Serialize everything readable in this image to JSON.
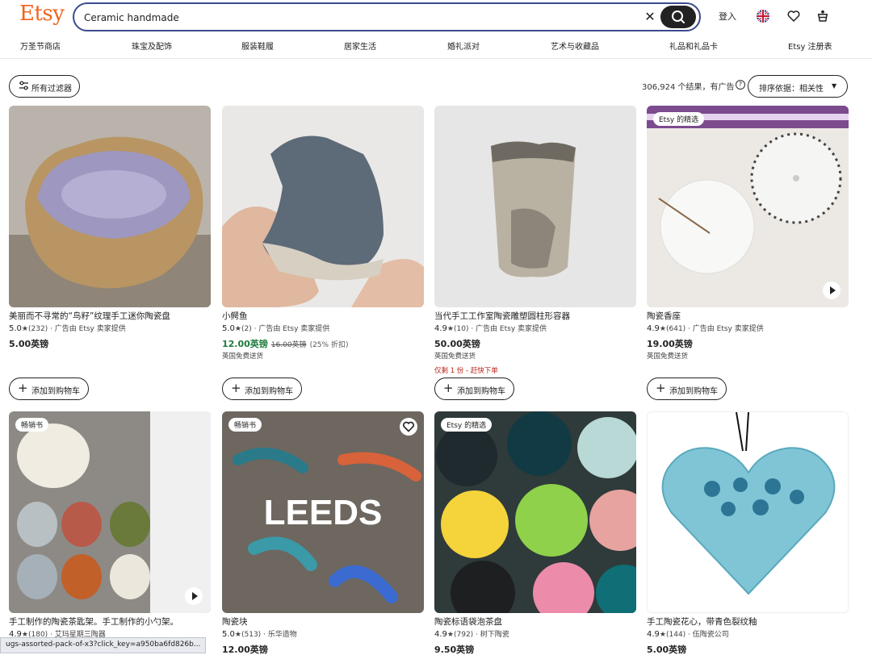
{
  "header": {
    "logo": "Etsy",
    "search_value": "Ceramic handmade",
    "signin": "登入"
  },
  "nav": [
    "万圣节商店",
    "珠宝及配饰",
    "服装鞋履",
    "居家生活",
    "婚礼派对",
    "艺术与收藏品",
    "礼品和礼品卡",
    "Etsy 注册表"
  ],
  "toolbar": {
    "filter_label": "所有过滤器",
    "results_text": "306,924 个结果，有广告",
    "sort_label": "排序依据：相关性"
  },
  "add_to_cart": "添加到购物车",
  "cards": [
    {
      "title": "美丽而不寻常的“鸟籽”纹理手工迷你陶瓷盘",
      "rating": "5.0",
      "reviews": "(232)",
      "seller": "广告由 Etsy 卖家提供",
      "price": "5.00英镑",
      "sale": false,
      "orig": "",
      "disc": "",
      "ship": "",
      "scarce": "",
      "badge": "",
      "video": false
    },
    {
      "title": "小鳄鱼",
      "rating": "5.0",
      "reviews": "(2)",
      "seller": "广告由 Etsy 卖家提供",
      "price": "12.00英镑",
      "sale": true,
      "orig": "16.00英镑",
      "disc": "(25% 折扣)",
      "ship": "英国免费送货",
      "scarce": "",
      "badge": "",
      "video": false
    },
    {
      "title": "当代手工工作室陶瓷雕塑圆柱形容器",
      "rating": "4.9",
      "reviews": "(10)",
      "seller": "广告由 Etsy 卖家提供",
      "price": "50.00英镑",
      "sale": false,
      "orig": "",
      "disc": "",
      "ship": "英国免费送货",
      "scarce": "仅剩 1 份 - 赶快下单",
      "badge": "",
      "video": false
    },
    {
      "title": "陶瓷香座",
      "rating": "4.9",
      "reviews": "(641)",
      "seller": "广告由 Etsy 卖家提供",
      "price": "19.00英镑",
      "sale": false,
      "orig": "",
      "disc": "",
      "ship": "英国免费送货",
      "scarce": "",
      "badge": "Etsy 的精选",
      "video": true
    },
    {
      "title": "手工制作的陶瓷茶匙架。手工制作的小勺架。",
      "rating": "4.9",
      "reviews": "(180)",
      "seller": "艾玛星期三陶器",
      "price": "",
      "sale": false,
      "orig": "",
      "disc": "",
      "ship": "",
      "scarce": "",
      "badge": "畅销书",
      "video": true
    },
    {
      "title": "陶瓷块",
      "rating": "5.0",
      "reviews": "(513)",
      "seller": "乐华造物",
      "price": "12.00英镑",
      "sale": false,
      "orig": "",
      "disc": "",
      "ship": "",
      "scarce": "",
      "badge": "畅销书",
      "video": false
    },
    {
      "title": "陶瓷标语袋泡茶盘",
      "rating": "4.9",
      "reviews": "(792)",
      "seller": "树下陶瓷",
      "price": "9.50英镑",
      "sale": false,
      "orig": "",
      "disc": "",
      "ship": "",
      "scarce": "",
      "badge": "Etsy 的精选",
      "video": false
    },
    {
      "title": "手工陶瓷花心，带青色裂纹釉",
      "rating": "4.9",
      "reviews": "(144)",
      "seller": "伍陶瓷公司",
      "price": "5.00英镑",
      "sale": false,
      "orig": "",
      "disc": "",
      "ship": "",
      "scarce": "",
      "badge": "",
      "video": false
    }
  ],
  "image_text": {
    "leeds": "LEEDS"
  },
  "status_url": "ugs-assorted-pack-of-x3?click_key=a950ba6fd826b...",
  "colors": {
    "brand": "#f1641e",
    "search_border": "#3b4a8f",
    "sale_green": "#1f7a3d",
    "scarce_red": "#b8231a"
  }
}
